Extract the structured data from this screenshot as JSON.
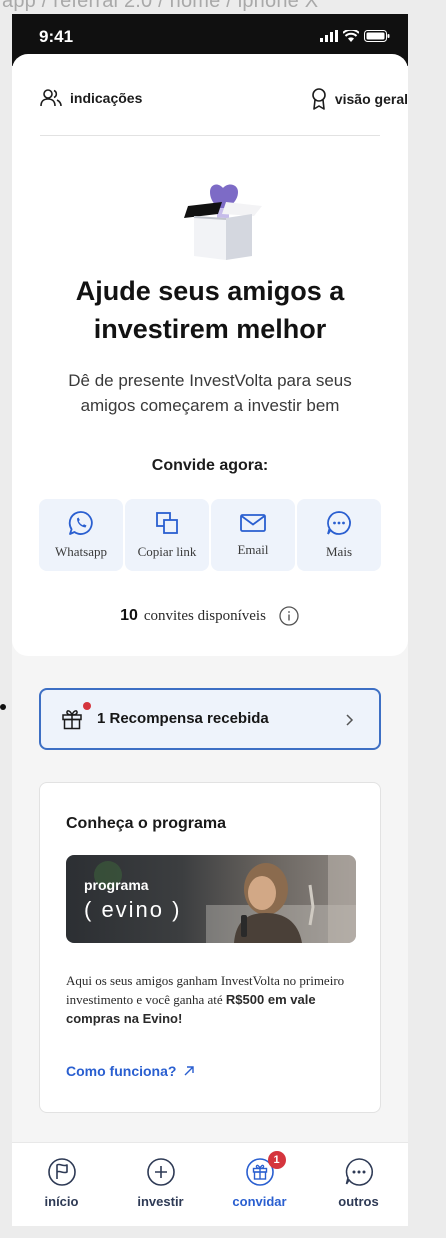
{
  "breadcrumb": "app / referral 2.0 / home / iphone X",
  "status": {
    "time": "9:41"
  },
  "nav": {
    "left_label": "indicações",
    "right_label": "visão geral"
  },
  "hero": {
    "headline": "Ajude seus amigos a investirem melhor",
    "subtext": "Dê de presente InvestVolta para seus amigos começarem a investir bem"
  },
  "invite": {
    "title": "Convide agora:",
    "buttons": [
      {
        "label": "Whatsapp",
        "icon": "whatsapp-icon"
      },
      {
        "label": "Copiar link",
        "icon": "copy-icon"
      },
      {
        "label": "Email",
        "icon": "mail-icon"
      },
      {
        "label": "Mais",
        "icon": "more-icon"
      }
    ],
    "count": "10",
    "count_label": "convites disponíveis"
  },
  "reward": {
    "label": "1 Recompensa recebida"
  },
  "program": {
    "title": "Conheça o programa",
    "banner_line1": "programa",
    "banner_line2": "( evino )",
    "desc_prefix": "Aqui os seus amigos ganham InvestVolta no primeiro investimento e você ganha até ",
    "desc_bold": "R$500 em vale compras na Evino!",
    "link": "Como funciona?"
  },
  "tabs": [
    {
      "label": "início",
      "icon": "flag-icon"
    },
    {
      "label": "investir",
      "icon": "plus-circle-icon"
    },
    {
      "label": "convidar",
      "icon": "gift-icon",
      "badge": "1",
      "active": true
    },
    {
      "label": "outros",
      "icon": "more-icon"
    }
  ],
  "colors": {
    "accent": "#2a5fd0",
    "badge": "#d5353d",
    "tile": "#eef3fb",
    "heart": "#7d6bc6"
  }
}
